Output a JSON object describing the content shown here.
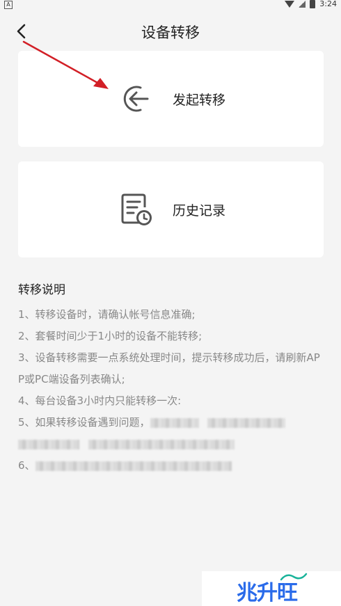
{
  "status_bar": {
    "left_badge": "A",
    "time": "3:24"
  },
  "header": {
    "title": "设备转移"
  },
  "cards": {
    "transfer": {
      "label": "发起转移",
      "icon": "arrow-back-circle-icon"
    },
    "history": {
      "label": "历史记录",
      "icon": "document-clock-icon"
    }
  },
  "notes": {
    "title": "转移说明",
    "items": [
      "1、转移设备时，请确认帐号信息准确;",
      "2、套餐时间少于1小时的设备不能转移;",
      "3、设备转移需要一点系统处理时间，提示转移成功后，请刷新APP或PC端设备列表确认;",
      "4、每台设备3小时内只能转移一次:",
      "5、如果转移设备遇到问题，",
      "6、"
    ]
  },
  "watermark": {
    "text": "兆升旺"
  },
  "colors": {
    "background": "#f4f4f4",
    "card": "#ffffff",
    "title_text": "#222222",
    "note_text": "#888888",
    "arrow_red": "#d21f26",
    "watermark_blue": "#2a6bea"
  }
}
